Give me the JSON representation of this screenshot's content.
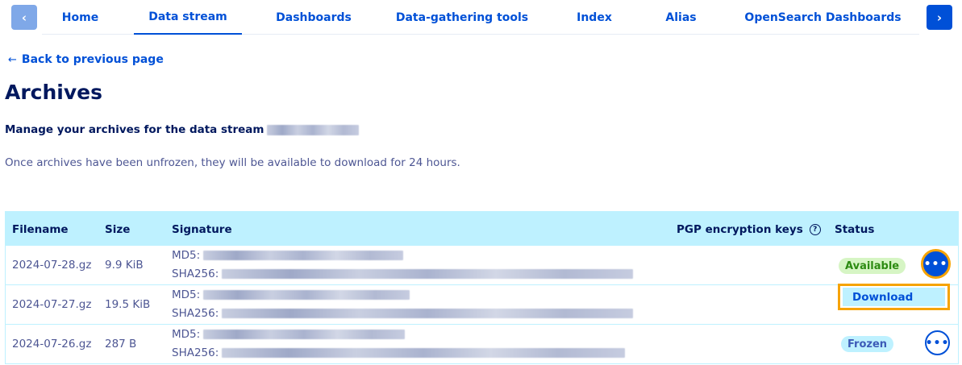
{
  "nav": {
    "prev_icon": "chevron-left-icon",
    "next_icon": "chevron-right-icon",
    "tabs": [
      {
        "label": "Home"
      },
      {
        "label": "Data stream"
      },
      {
        "label": "Dashboards"
      },
      {
        "label": "Data-gathering tools"
      },
      {
        "label": "Index"
      },
      {
        "label": "Alias"
      },
      {
        "label": "OpenSearch Dashboards"
      }
    ],
    "active_tab": "Data stream"
  },
  "back_link": {
    "arrow": "←",
    "label": "Back to previous page"
  },
  "page_title": "Archives",
  "subtitle": "Manage your archives for the data stream",
  "info_text": "Once archives have been unfrozen, they will be available to download for 24 hours.",
  "table": {
    "headers": {
      "filename": "Filename",
      "size": "Size",
      "signature": "Signature",
      "pgp": "PGP encryption keys",
      "status": "Status"
    },
    "help_icon_glyph": "?",
    "md5_label": "MD5:",
    "sha256_label": "SHA256:",
    "rows": [
      {
        "filename": "2024-07-28.gz",
        "size": "9.9 KiB",
        "status": "Available"
      },
      {
        "filename": "2024-07-27.gz",
        "size": "19.5 KiB",
        "status": ""
      },
      {
        "filename": "2024-07-26.gz",
        "size": "287 B",
        "status": "Frozen"
      }
    ],
    "more_glyph": "•••"
  },
  "action_menu": {
    "item": "Download"
  },
  "colors": {
    "accent": "#0050d7",
    "header_bg": "#bef1ff",
    "available_bg": "#d6f5c4",
    "focus_outline": "#f6a300"
  }
}
